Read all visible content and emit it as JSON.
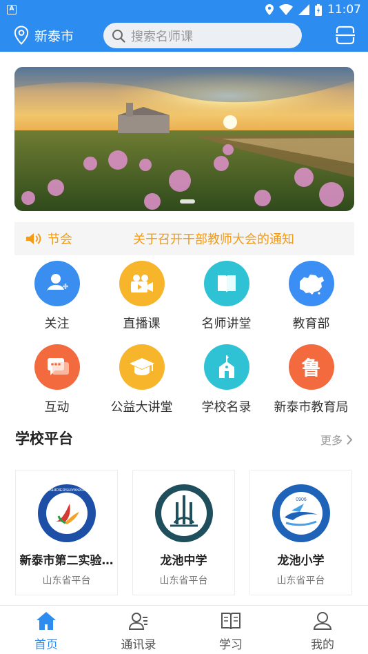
{
  "status_bar": {
    "time": "11:07",
    "badge": "A"
  },
  "header": {
    "location": "新泰市",
    "search_placeholder": "搜索名师课"
  },
  "notice": {
    "tag": "节会",
    "text": "关于召开干部教师大会的通知"
  },
  "grid": [
    {
      "label": "关注",
      "icon": "follow-user-icon",
      "color": "#3a8ef0"
    },
    {
      "label": "直播课",
      "icon": "video-camera-icon",
      "color": "#f7b52c"
    },
    {
      "label": "名师讲堂",
      "icon": "book-icon",
      "color": "#2fc2d4"
    },
    {
      "label": "教育部",
      "icon": "china-map-icon",
      "color": "#3b8ef3"
    },
    {
      "label": "互动",
      "icon": "chat-icon",
      "color": "#f26a3d"
    },
    {
      "label": "公益大讲堂",
      "icon": "graduation-cap-icon",
      "color": "#f7b52c"
    },
    {
      "label": "学校名录",
      "icon": "school-building-icon",
      "color": "#2fc2d4"
    },
    {
      "label": "新泰市教育局",
      "icon": "lu-character-icon",
      "color": "#f26a3d",
      "glyph": "鲁"
    }
  ],
  "schools_section": {
    "title": "学校平台",
    "more": "更多",
    "items": [
      {
        "name": "新泰市第二实验…",
        "sub": "山东省平台",
        "ring_text": "XINTAISHIDIERSHIYANXIAOXUE"
      },
      {
        "name": "龙池中学",
        "sub": "山东省平台"
      },
      {
        "name": "龙池小学",
        "sub": "山东省平台",
        "badge_text": "0906"
      }
    ]
  },
  "tabbar": [
    {
      "label": "首页",
      "icon": "home-icon",
      "active": true
    },
    {
      "label": "通讯录",
      "icon": "contacts-icon",
      "active": false
    },
    {
      "label": "学习",
      "icon": "open-book-icon",
      "active": false
    },
    {
      "label": "我的",
      "icon": "profile-icon",
      "active": false
    }
  ],
  "colors": {
    "primary": "#2d8cf0",
    "notice": "#f39b14"
  }
}
